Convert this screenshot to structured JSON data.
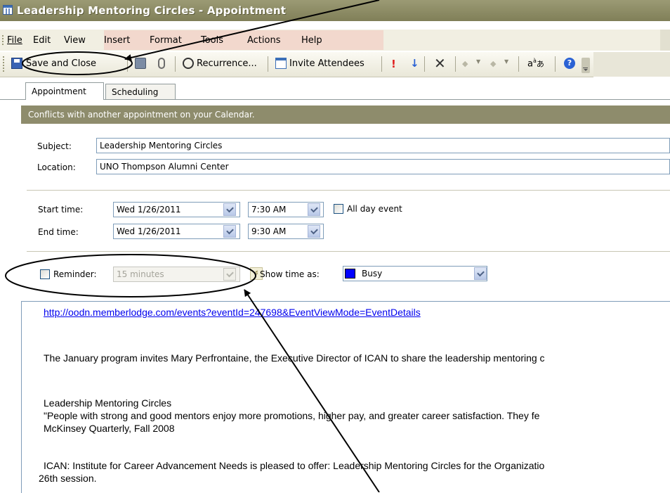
{
  "window": {
    "title": "Leadership Mentoring Circles - Appointment"
  },
  "menu": {
    "file": "File",
    "edit": "Edit",
    "view": "View",
    "insert": "Insert",
    "format": "Format",
    "tools": "Tools",
    "actions": "Actions",
    "help": "Help"
  },
  "toolbar": {
    "save_close": "Save and Close",
    "recurrence": "Recurrence...",
    "invite": "Invite Attendees"
  },
  "tabs": {
    "appointment": "Appointment",
    "scheduling": "Scheduling"
  },
  "infobar": {
    "message": "Conflicts with another appointment on your Calendar."
  },
  "form": {
    "subject_label": "Subject:",
    "subject_value": "Leadership Mentoring Circles",
    "location_label": "Location:",
    "location_value": "UNO Thompson Alumni Center",
    "start_label": "Start time:",
    "start_date": "Wed 1/26/2011",
    "start_time": "7:30 AM",
    "allday_label": "All day event",
    "end_label": "End time:",
    "end_date": "Wed 1/26/2011",
    "end_time": "9:30 AM",
    "reminder_label": "Reminder:",
    "reminder_value": "15 minutes",
    "showtime_label": "Show time as:",
    "showtime_value": "Busy",
    "busy_color": "#0000ff"
  },
  "body": {
    "url": "http://oodn.memberlodge.com/events?eventId=247698&EventViewMode=EventDetails",
    "para1": "The January program invites Mary Perfrontaine, the Executive Director of ICAN to share the leadership mentoring c",
    "heading": "Leadership Mentoring Circles",
    "quote": "\"People with strong and good mentors enjoy more promotions, higher pay, and greater career satisfaction.  They fe",
    "source": "McKinsey Quarterly, Fall 2008",
    "para3a": "ICAN: Institute for Career Advancement Needs is pleased to offer: Leadership Mentoring Circles for the Organizatio",
    "para3b": "26th session."
  },
  "colors": {
    "title_bar": "#8e8d66",
    "infobar": "#8e8c6c",
    "menu_highlight": "#f2d8cd",
    "annotation": "#000000"
  }
}
